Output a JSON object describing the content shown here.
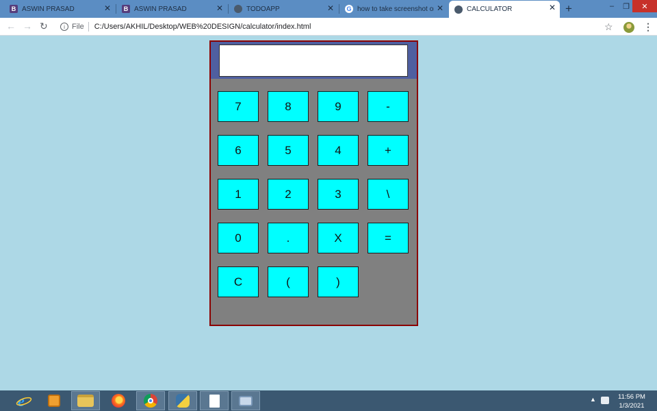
{
  "browser": {
    "tabs": [
      {
        "title": "ASWIN PRASAD",
        "icon": "bootstrap-icon",
        "glyph": "B"
      },
      {
        "title": "ASWIN PRASAD",
        "icon": "bootstrap-icon",
        "glyph": "B"
      },
      {
        "title": "TODOAPP",
        "icon": "globe-icon",
        "glyph": ""
      },
      {
        "title": "how to take screenshot on la",
        "icon": "google-icon",
        "glyph": "G"
      },
      {
        "title": "CALCULATOR",
        "icon": "globe-icon",
        "glyph": "",
        "active": true
      }
    ],
    "close_glyph": "✕",
    "new_tab_glyph": "+",
    "window_controls": {
      "minimize": "–",
      "restore": "❐",
      "close": "✕"
    },
    "nav": {
      "back": "←",
      "forward": "→",
      "reload": "↻"
    },
    "url_scheme": "File",
    "url_info_glyph": "i",
    "url": "C:/Users/AKHIL/Desktop/WEB%20DESIGN/calculator/index.html",
    "star_glyph": "☆",
    "menu_glyph": "⋮"
  },
  "calculator": {
    "display_value": "",
    "keys": [
      [
        "7",
        "8",
        "9",
        "-"
      ],
      [
        "6",
        "5",
        "4",
        "+"
      ],
      [
        "1",
        "2",
        "3",
        "\\"
      ],
      [
        "0",
        ".",
        "X",
        "="
      ],
      [
        "C",
        "(",
        ")"
      ]
    ],
    "colors": {
      "key_bg": "#00ffff",
      "body_bg": "#808080",
      "border": "#8b0000",
      "display_band": "#4f5fa0",
      "page_bg": "#add8e6"
    }
  },
  "taskbar": {
    "apps": [
      "internet-explorer-icon",
      "media-player-icon",
      "file-explorer-icon",
      "firefox-icon",
      "chrome-icon",
      "python-icon",
      "notepad-icon",
      "network-drive-icon"
    ],
    "tray_arrow": "▲",
    "clock_time": "11:56 PM",
    "clock_date": "1/3/2021"
  }
}
